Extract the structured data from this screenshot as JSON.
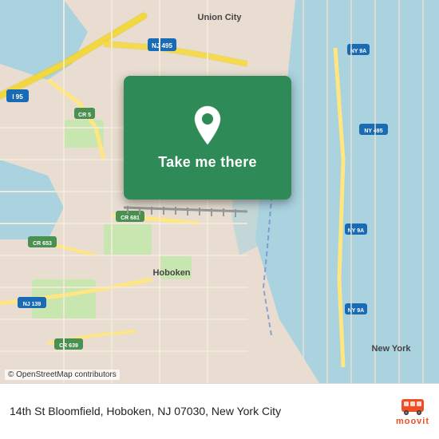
{
  "map": {
    "background_color": "#e8ddd0",
    "water_color": "#aad3df",
    "green_color": "#c8e6b0",
    "road_color": "#f9f3e8",
    "road_stroke": "#ccc",
    "highway_color": "#ffe680",
    "highway_stroke": "#e6c800"
  },
  "card": {
    "background": "#2e8b57",
    "pin_icon": "location-pin",
    "button_label": "Take me there"
  },
  "attribution": {
    "text": "© OpenStreetMap contributors"
  },
  "bottom_bar": {
    "address": "14th St Bloomfield, Hoboken, NJ 07030, New York City"
  },
  "moovit": {
    "label": "moovit"
  }
}
